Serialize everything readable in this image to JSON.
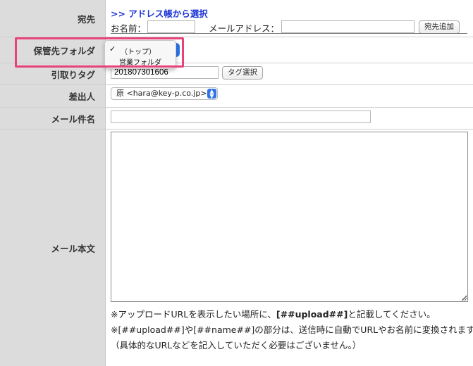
{
  "labels": {
    "to": "宛先",
    "folder": "保管先フォルダ",
    "tag": "引取りタグ",
    "from": "差出人",
    "subject": "メール件名",
    "body": "メール本文"
  },
  "to": {
    "address_book_link": ">> アドレス帳から選択",
    "name_label": "お名前：",
    "name_value": "",
    "email_label": "メールアドレス：",
    "email_value": "",
    "add_button": "宛先追加"
  },
  "folder": {
    "options": [
      "（トップ）",
      "営業フォルダ"
    ],
    "selected": "（トップ）",
    "check_mark": "✓"
  },
  "tag": {
    "value": "201807301606",
    "select_button": "タグ選択"
  },
  "from": {
    "value": "原 <hara@key-p.co.jp>"
  },
  "subject": {
    "value": ""
  },
  "body": {
    "value": "",
    "note1_prefix": "※アップロードURLを表示したい場所に、",
    "note1_tag": "[##upload##]",
    "note1_suffix": "と記載してください。",
    "note2": "※[##upload##]や[##name##]の部分は、送信時に自動でURLやお名前に変換されます。",
    "note3": "（具体的なURLなどを記入していただく必要はございません。）"
  },
  "colors": {
    "highlight": "#e8427a",
    "link": "#1a33d6",
    "select_accent": "#2e74e8"
  },
  "icons": {
    "check": "checkmark-icon",
    "select_arrow": "updown-chevron-icon",
    "resize": "resize-grip-icon"
  }
}
